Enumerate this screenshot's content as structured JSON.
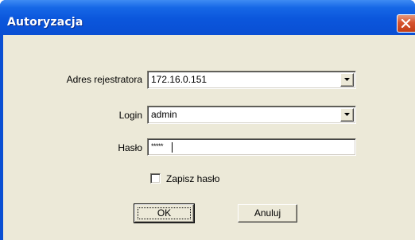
{
  "window": {
    "title": "Autoryzacja",
    "close_icon": "close-icon"
  },
  "form": {
    "address": {
      "label": "Adres rejestratora",
      "value": "172.16.0.151"
    },
    "login": {
      "label": "Login",
      "value": "admin"
    },
    "password": {
      "label": "Hasło",
      "value": "*****"
    },
    "save_password": {
      "label": "Zapisz hasło",
      "checked": false
    }
  },
  "buttons": {
    "ok": "OK",
    "cancel": "Anuluj"
  }
}
